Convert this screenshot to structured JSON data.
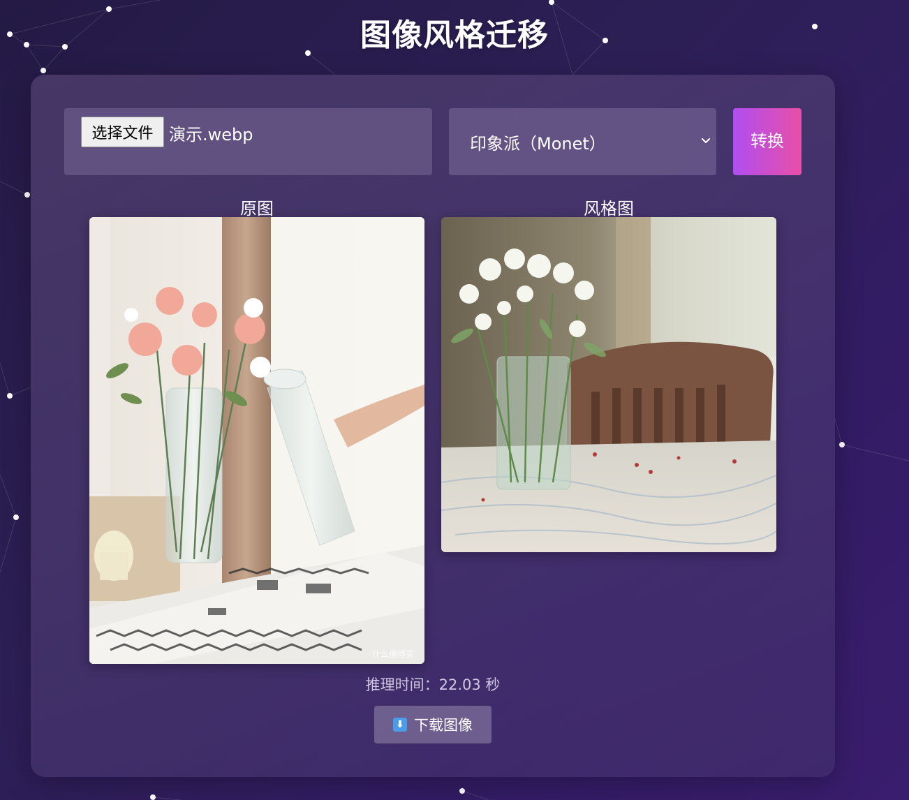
{
  "page": {
    "title": "图像风格迁移"
  },
  "controls": {
    "file_button_label": "选择文件",
    "file_name": "演示.webp",
    "style_selected": "印象派（Monet）",
    "convert_label": "转换"
  },
  "images": {
    "original_label": "原图",
    "styled_label": "风格图",
    "watermark": "什么值得买"
  },
  "result": {
    "inference_time": "推理时间：22.03 秒",
    "download_label": "下载图像"
  },
  "icons": {
    "dropdown": "chevron-down-icon",
    "download": "download-arrow-icon"
  },
  "colors": {
    "convert_gradient_start": "#b04ef0",
    "convert_gradient_end": "#e84fa7",
    "background": "#2c1f55"
  }
}
